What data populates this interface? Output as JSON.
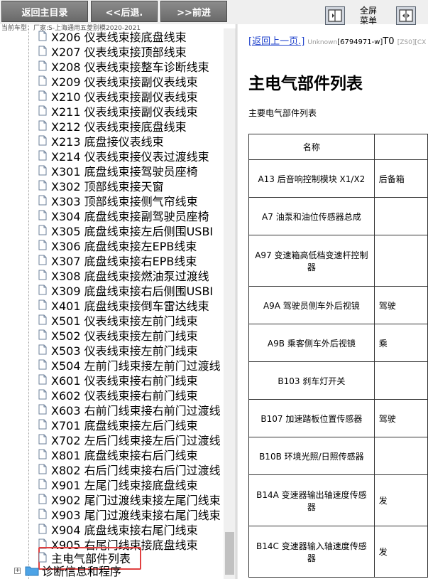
{
  "toolbar": {
    "home_label": "返回主目录",
    "back_label": "<<后退.",
    "forward_label": ">>前进",
    "fullscreen_line1": "全屏",
    "fullscreen_line2": "菜单"
  },
  "vehicle_info": "当前车型：厂家:S-上海通用五菱别模2020-2021",
  "tree": {
    "items": [
      "X206 仪表线束接底盘线束",
      "X207 仪表线束接顶部线束",
      "X208 仪表线束接整车诊断线束",
      "X209 仪表线束接副仪表线束",
      "X210 仪表线束接副仪表线束",
      "X211 仪表线束接副仪表线束",
      "X212 仪表线束接底盘线束",
      "X213 底盘接仪表线束",
      "X214 仪表线束接仪表过渡线束",
      "X301 底盘线束接驾驶员座椅",
      "X302 顶部线束接天窗",
      "X303 顶部线束接侧气帘线束",
      "X304 底盘线束接副驾驶员座椅",
      "X305 底盘线束接左后侧围USBI",
      "X306 底盘线束接左EPB线束",
      "X307 底盘线束接右EPB线束",
      "X308 底盘线束接燃油泵过渡线",
      "X309 底盘线束接右后侧围USBI",
      "X401 底盘线束接倒车雷达线束",
      "X501 仪表线束接左前门线束",
      "X502 仪表线束接左前门线束",
      "X503 仪表线束接左前门线束",
      "X504 左前门线束接左前门过渡线",
      "X601 仪表线束接右前门线束",
      "X602 仪表线束接右前门线束",
      "X603 右前门线束接右前门过渡线",
      "X701 底盘线束接左后门线束",
      "X702 左后门线束接左后门过渡线",
      "X801 底盘线束接右后门线束",
      "X802 右后门线束接右后门过渡线",
      "X901 左尾门线束接底盘线束",
      "X902 尾门过渡线束接左尾门线束",
      "X903 尾门过渡线束接右尾门线束",
      "X904 底盘线束接右尾门线束",
      "X905 右尾门线束接底盘线束"
    ],
    "selected_item": "主电气部件列表",
    "folder_label": "诊断信息和程序"
  },
  "content": {
    "back_link": "[返回上一页.]",
    "doc_id_prefix": "Unknown",
    "doc_id": "[6794971-w]",
    "doc_code": "T0",
    "doc_tail": "[ZS0][CX",
    "title": "主电气部件列表",
    "subtitle": "主要电气部件列表",
    "table": {
      "header_name": "名称",
      "rows": [
        {
          "name": "A13 后音响控制模块 X1/X2",
          "col2": "后备箱"
        },
        {
          "name": "A7 油泵和油位传感器总成",
          "col2": ""
        },
        {
          "name": "A97 变速箱高低档变速杆控制器",
          "col2": ""
        },
        {
          "name": "A9A 驾驶员侧车外后视镜",
          "col2": "驾驶"
        },
        {
          "name": "A9B 乘客侧车外后视镜",
          "col2": "乘"
        },
        {
          "name": "B103 刹车灯开关",
          "col2": ""
        },
        {
          "name": "B107 加速踏板位置传感器",
          "col2": "驾驶"
        },
        {
          "name": "B10B 环境光照/日照传感器",
          "col2": ""
        },
        {
          "name": "B14A 变速器输出轴速度传感器",
          "col2": "发"
        },
        {
          "name": "B14C 变速器输入轴速度传感器",
          "col2": "发"
        }
      ]
    }
  }
}
